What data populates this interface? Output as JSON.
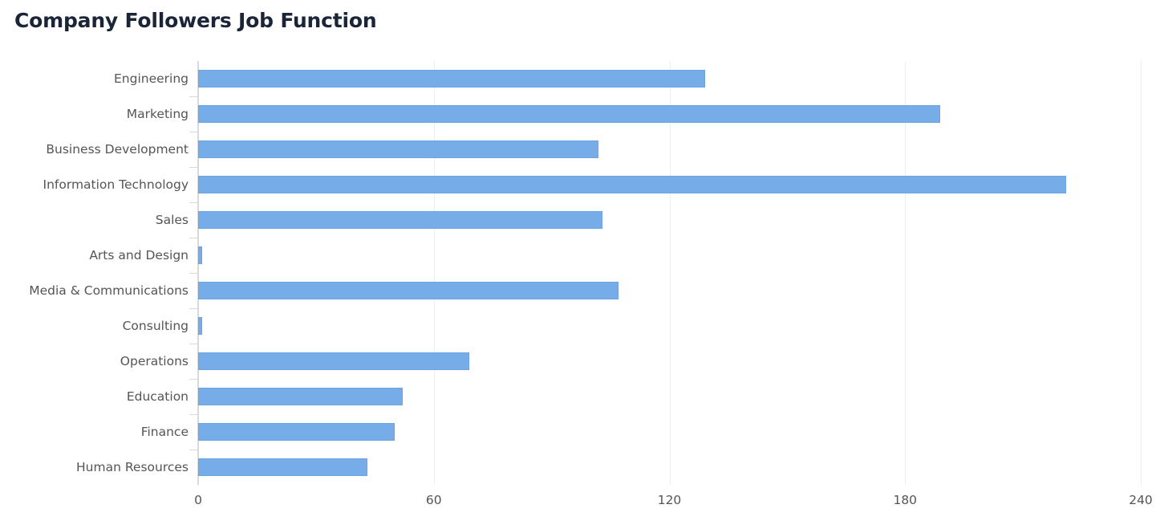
{
  "chart_data": {
    "type": "bar",
    "orientation": "horizontal",
    "title": "Company Followers Job Function",
    "xlabel": "",
    "ylabel": "",
    "categories": [
      "Engineering",
      "Marketing",
      "Business Development",
      "Information Technology",
      "Sales",
      "Arts and Design",
      "Media & Communications",
      "Consulting",
      "Operations",
      "Education",
      "Finance",
      "Human Resources"
    ],
    "values": [
      129,
      189,
      102,
      221,
      103,
      1,
      107,
      1,
      69,
      52,
      50,
      43
    ],
    "xlim": [
      0,
      240
    ],
    "xticks": [
      0,
      60,
      120,
      180,
      240
    ],
    "xtick_labels": [
      "0",
      "60",
      "120",
      "180",
      "240"
    ],
    "grid": "vertical",
    "legend": "none",
    "bar_color": "#76ace8",
    "bar_border_color": "#6ba4e0",
    "title_color": "#1b2538",
    "tick_label_color": "#555555",
    "gridline_color": "#eeeeee",
    "axis_color": "#d9d9d9",
    "background_color": "#ffffff"
  }
}
